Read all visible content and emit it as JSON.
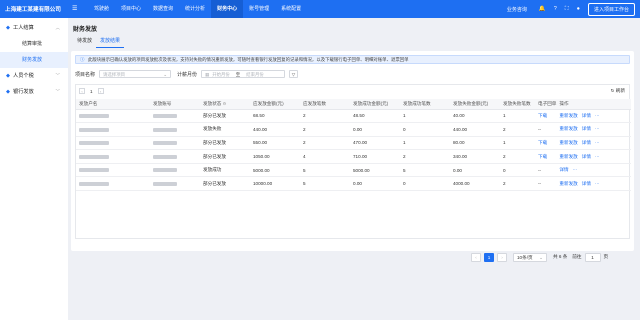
{
  "app": {
    "brand": "上海建工某建有限公司",
    "nav": [
      "驾驶舱",
      "项目中心",
      "数据查询",
      "统计分析",
      "财务中心",
      "账号管理",
      "系统配置"
    ],
    "service": "业务咨询",
    "enter_button": "进入项目工作台"
  },
  "sidebar": {
    "groups": [
      {
        "label": "工人结算",
        "items": [
          "结算审批",
          "财务发放"
        ]
      },
      {
        "label": "人员个税",
        "items": []
      },
      {
        "label": "银行发放",
        "items": []
      }
    ]
  },
  "page": {
    "title": "财务发放",
    "tabs": [
      "待发放",
      "发放结果"
    ],
    "notice": "此版块展示已确认发放的项目发放批次及状况，支持对失败的情况重新发放，可随时查看银行发放回复的记录和情况，以及下载银行电子回单、明细对账单、退票回单"
  },
  "filter": {
    "project_label": "项目名称",
    "project_placeholder": "请选择项目",
    "month_label": "计薪月份",
    "start_placeholder": "开始月份",
    "to": "至",
    "end_placeholder": "结束月份"
  },
  "table": {
    "pager": {
      "page": "1"
    },
    "refresh": "刷新",
    "columns": [
      "发放户名",
      "发放账号",
      "发放状态",
      "应发放金额(元)",
      "应发放笔数",
      "发放成功金额(元)",
      "发放成功笔数",
      "发放失败金额(元)",
      "发放失败笔数",
      "电子回单",
      "操作"
    ],
    "rows": [
      {
        "status": "部分已发放",
        "should_amt": "68.50",
        "should_cnt": "2",
        "succ_amt": "48.50",
        "succ_cnt": "1",
        "fail_amt": "40.00",
        "fail_cnt": "1",
        "receipt": "下载",
        "actions": [
          "重新发放",
          "详情"
        ]
      },
      {
        "status": "发放失败",
        "should_amt": "440.00",
        "should_cnt": "2",
        "succ_amt": "0.00",
        "succ_cnt": "0",
        "fail_amt": "440.00",
        "fail_cnt": "2",
        "receipt": "--",
        "actions": [
          "重新发放",
          "详情"
        ]
      },
      {
        "status": "部分已发放",
        "should_amt": "550.00",
        "should_cnt": "2",
        "succ_amt": "470.00",
        "succ_cnt": "1",
        "fail_amt": "80.00",
        "fail_cnt": "1",
        "receipt": "下载",
        "actions": [
          "重新发放",
          "详情"
        ]
      },
      {
        "status": "部分已发放",
        "should_amt": "1050.00",
        "should_cnt": "4",
        "succ_amt": "710.00",
        "succ_cnt": "2",
        "fail_amt": "340.00",
        "fail_cnt": "2",
        "receipt": "下载",
        "actions": [
          "重新发放",
          "详情"
        ]
      },
      {
        "status": "发放成功",
        "should_amt": "5000.00",
        "should_cnt": "5",
        "succ_amt": "5000.00",
        "succ_cnt": "5",
        "fail_amt": "0.00",
        "fail_cnt": "0",
        "receipt": "--",
        "actions": [
          "详情"
        ]
      },
      {
        "status": "部分已发放",
        "should_amt": "10000.00",
        "should_cnt": "5",
        "succ_amt": "0.00",
        "succ_cnt": "0",
        "fail_amt": "4000.00",
        "fail_cnt": "2",
        "receipt": "--",
        "actions": [
          "重新发放",
          "详情"
        ]
      }
    ]
  },
  "pagination": {
    "current": "1",
    "page_size": "10条/页",
    "total": "共 6 条",
    "goto_label": "前往",
    "goto_value": "1",
    "page_suffix": "页"
  },
  "colors": {
    "primary": "#1e6ff2",
    "nav_active": "#165ed4",
    "sidebar_active_bg": "#e8f0fe"
  }
}
